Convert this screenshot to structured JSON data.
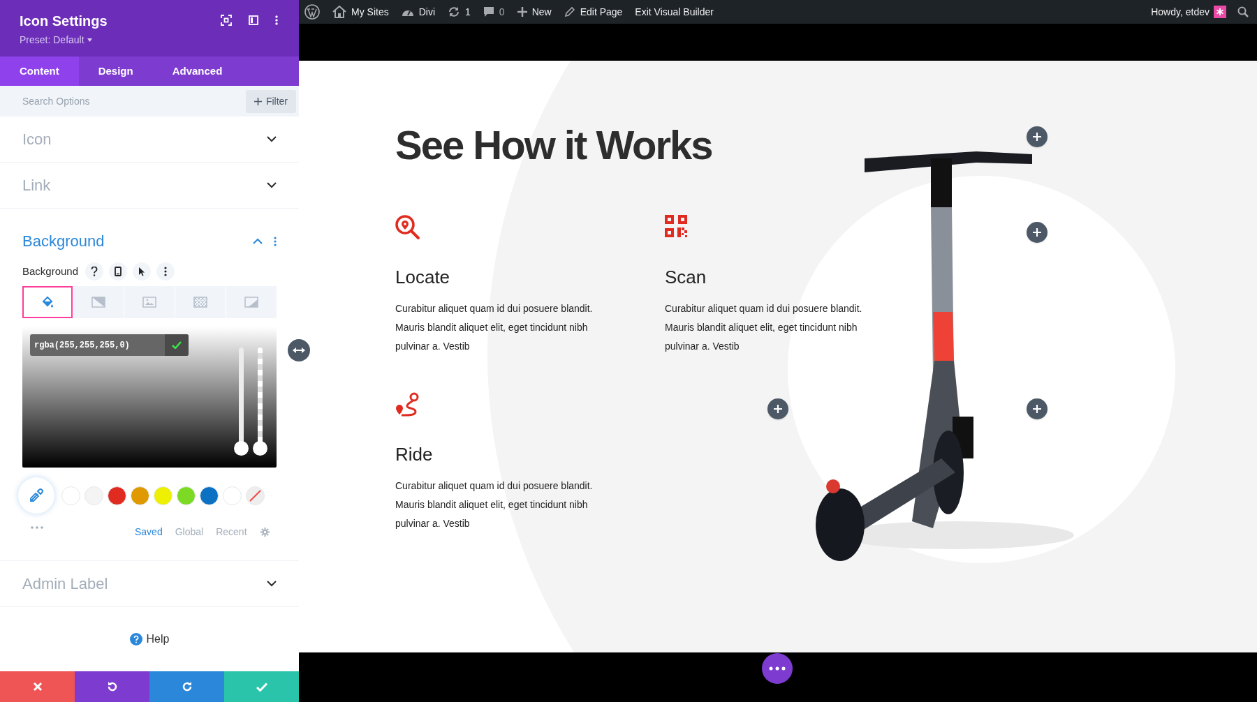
{
  "panel": {
    "title": "Icon Settings",
    "preset": "Preset: Default",
    "tabs": [
      {
        "label": "Content",
        "selected": true
      },
      {
        "label": "Design",
        "selected": false
      },
      {
        "label": "Advanced",
        "selected": false
      }
    ],
    "search": {
      "placeholder": "Search Options"
    },
    "filter_button": "Filter",
    "sections": [
      {
        "title": "Icon",
        "expanded": false
      },
      {
        "title": "Link",
        "expanded": false
      },
      {
        "title": "Background",
        "expanded": true,
        "field_label": "Background",
        "type_tabs": [
          {
            "kind": "color",
            "selected": true
          },
          {
            "kind": "gradient",
            "selected": false
          },
          {
            "kind": "image",
            "selected": false
          },
          {
            "kind": "pattern",
            "selected": false
          },
          {
            "kind": "mask",
            "selected": false
          }
        ],
        "color_value": "rgba(255,255,255,0)",
        "sliders": [
          {
            "kind": "hue",
            "level": 0
          },
          {
            "kind": "alpha",
            "level": 0
          }
        ],
        "swatches": [
          {
            "kind": "solid",
            "color": "#ffffff"
          },
          {
            "kind": "solid",
            "color": "#f4f4f4"
          },
          {
            "kind": "solid",
            "color": "#e02b20"
          },
          {
            "kind": "solid",
            "color": "#e09900"
          },
          {
            "kind": "solid",
            "color": "#edf000"
          },
          {
            "kind": "solid",
            "color": "#7cda24"
          },
          {
            "kind": "solid",
            "color": "#0c71c3"
          },
          {
            "kind": "solid",
            "color": "#ffffff"
          },
          {
            "kind": "none"
          }
        ],
        "palette_tabs": [
          {
            "label": "Saved",
            "selected": true
          },
          {
            "label": "Global",
            "selected": false
          },
          {
            "label": "Recent",
            "selected": false
          }
        ]
      },
      {
        "title": "Admin Label",
        "expanded": false
      }
    ],
    "help": "Help",
    "footer_buttons": [
      {
        "kind": "discard"
      },
      {
        "kind": "undo"
      },
      {
        "kind": "redo"
      },
      {
        "kind": "save"
      }
    ]
  },
  "admin_bar": {
    "items": [
      {
        "kind": "wordpress"
      },
      {
        "kind": "sites",
        "label": "My Sites"
      },
      {
        "kind": "divi",
        "label": "Divi"
      },
      {
        "kind": "updates",
        "label": "1"
      },
      {
        "kind": "comments",
        "label": "0"
      },
      {
        "kind": "new",
        "label": "New"
      },
      {
        "kind": "edit",
        "label": "Edit Page"
      },
      {
        "kind": "text",
        "label": "Exit Visual Builder"
      }
    ],
    "greeting": "Howdy, etdev"
  },
  "page": {
    "title": "See How it Works",
    "features": [
      {
        "kind": "locate",
        "title": "Locate",
        "text": "Curabitur aliquet quam id dui posuere blandit. Mauris blandit aliquet elit, eget tincidunt nibh pulvinar a. Vestib"
      },
      {
        "kind": "scan",
        "title": "Scan",
        "text": "Curabitur aliquet quam id dui posuere blandit. Mauris blandit aliquet elit, eget tincidunt nibh pulvinar a. Vestib"
      },
      {
        "kind": "ride",
        "title": "Ride",
        "text": "Curabitur aliquet quam id dui posuere blandit. Mauris blandit aliquet elit, eget tincidunt nibh pulvinar a. Vestib"
      }
    ]
  }
}
